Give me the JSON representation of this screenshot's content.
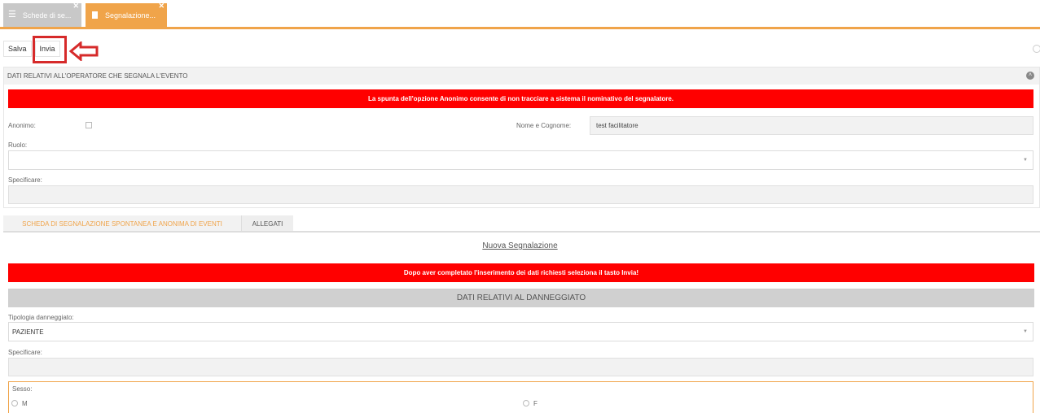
{
  "tabs": [
    {
      "label": "Schede di se...",
      "icon": "list-icon",
      "active": false
    },
    {
      "label": "Segnalazione...",
      "icon": "document-icon",
      "active": true
    }
  ],
  "toolbar": {
    "save_label": "Salva",
    "send_label": "Invia"
  },
  "operator_section": {
    "title": "DATI RELATIVI ALL'OPERATORE CHE SEGNALA L'EVENTO",
    "notice": "La spunta dell'opzione Anonimo consente di non tracciare a sistema il nominativo del segnalatore.",
    "anonymous_label": "Anonimo:",
    "anonymous_checked": false,
    "name_label": "Nome e Cognome:",
    "name_value": "test facilitatore",
    "role_label": "Ruolo:",
    "role_value": "",
    "specify_label": "Specificare:",
    "specify_value": ""
  },
  "content_tabs": [
    {
      "label": "SCHEDA DI SEGNALAZIONE SPONTANEA E ANONIMA DI EVENTI",
      "active": true
    },
    {
      "label": "ALLEGATI",
      "active": false
    }
  ],
  "form": {
    "title": "Nuova Segnalazione",
    "notice": "Dopo aver completato l'inserimento dei dati richiesti seleziona il tasto Invia!",
    "section_title": "DATI RELATIVI AL DANNEGGIATO",
    "damaged_type_label": "Tipologia danneggiato:",
    "damaged_type_value": "PAZIENTE",
    "specify_label": "Specificare:",
    "specify_value": "",
    "sex_label": "Sesso:",
    "sex_options": [
      "M",
      "F"
    ]
  },
  "colors": {
    "accent": "#f0a44a",
    "alert": "#ff0000",
    "highlight": "#d62a2a"
  }
}
